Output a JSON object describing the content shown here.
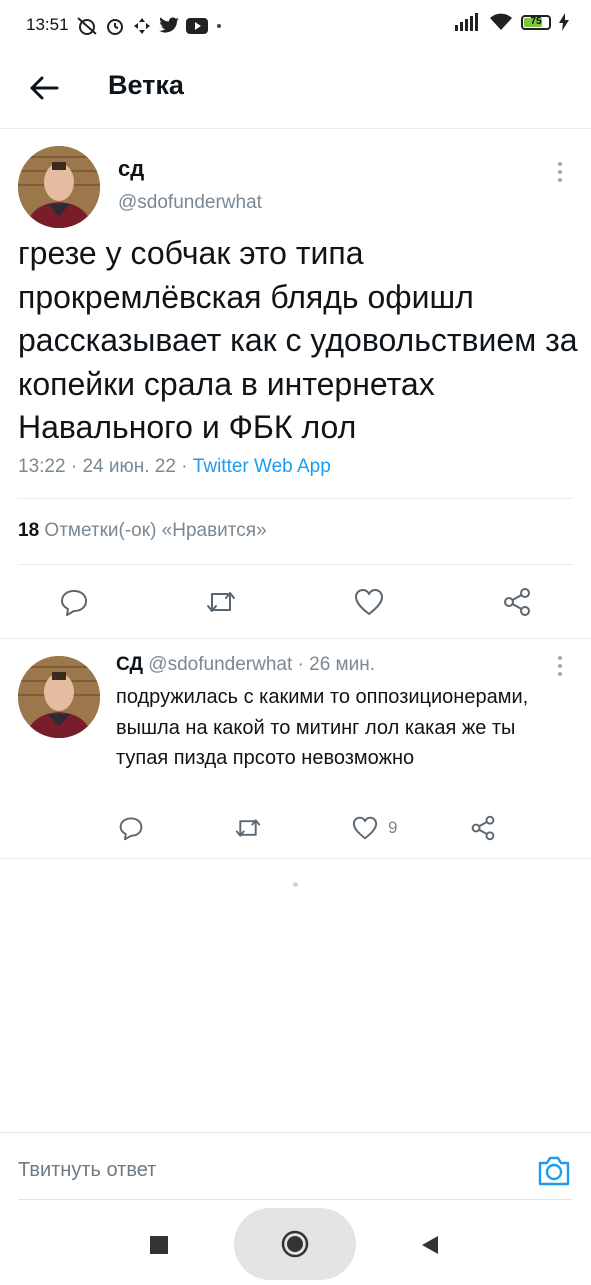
{
  "status_bar": {
    "time": "13:51",
    "battery_level": "75",
    "icons": [
      "alarm-off-icon",
      "alarm-clock-icon",
      "move-icon",
      "twitter-bird-icon",
      "youtube-icon",
      "dot-icon",
      "signal-icon",
      "wifi-icon",
      "battery-icon",
      "charging-bolt-icon"
    ]
  },
  "header": {
    "title": "Ветка"
  },
  "main_tweet": {
    "display_name": "сд",
    "handle": "@sdofunderwhat",
    "text": "грезе у собчак это типа прокремлёвская блядь офишл рассказывает как с удовольствием за копейки срала в интернетах Навального и ФБК лол",
    "time": "13:22",
    "date": "24 июн. 22",
    "source": "Twitter Web App",
    "likes_count": "18",
    "likes_label": "Отметки(-ок) «Нравится»"
  },
  "reply": {
    "display_name": "СД",
    "handle": "@sdofunderwhat",
    "age": "26 мин.",
    "text": "подружилась с какими то оппозиционерами, вышла на какой то митинг лол какая же ты тупая пизда прсото невозможно",
    "likes": "9"
  },
  "compose": {
    "placeholder": "Твитнуть ответ"
  },
  "colors": {
    "accent": "#1d9bf0",
    "muted": "#7a8893",
    "divider": "#e6ecf0"
  }
}
